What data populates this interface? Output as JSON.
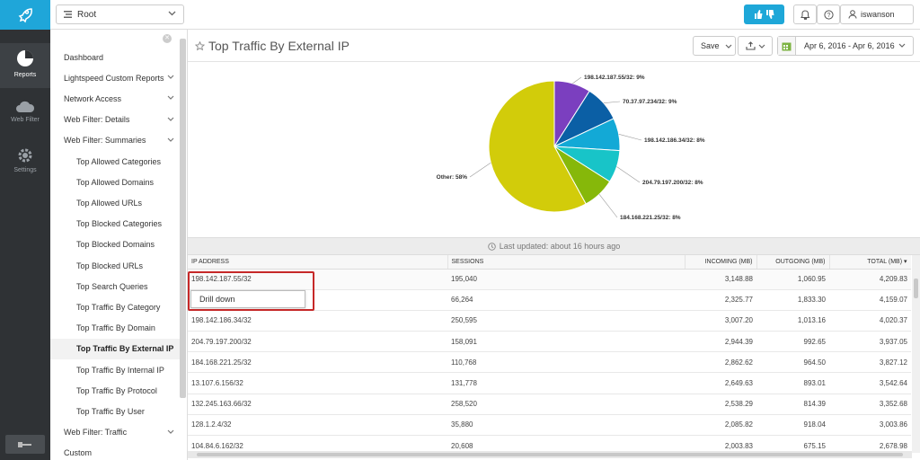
{
  "rail": {
    "items": [
      {
        "label": "Reports",
        "icon": "pie-chart-icon",
        "active": true
      },
      {
        "label": "Web Filter",
        "icon": "cloud-icon",
        "active": false
      },
      {
        "label": "Settings",
        "icon": "gear-icon",
        "active": false
      }
    ]
  },
  "topbar": {
    "root_label": "Root",
    "username": "iswanson"
  },
  "sidenav": {
    "items": [
      {
        "label": "Dashboard",
        "level": 1,
        "chevron": false
      },
      {
        "label": "Lightspeed Custom Reports",
        "level": 1,
        "chevron": true
      },
      {
        "label": "Network Access",
        "level": 1,
        "chevron": true
      },
      {
        "label": "Web Filter: Details",
        "level": 1,
        "chevron": true
      },
      {
        "label": "Web Filter: Summaries",
        "level": 1,
        "chevron": true
      },
      {
        "label": "Top Allowed Categories",
        "level": 2
      },
      {
        "label": "Top Allowed Domains",
        "level": 2
      },
      {
        "label": "Top Allowed URLs",
        "level": 2
      },
      {
        "label": "Top Blocked Categories",
        "level": 2
      },
      {
        "label": "Top Blocked Domains",
        "level": 2
      },
      {
        "label": "Top Blocked URLs",
        "level": 2
      },
      {
        "label": "Top Search Queries",
        "level": 2
      },
      {
        "label": "Top Traffic By Category",
        "level": 2
      },
      {
        "label": "Top Traffic By Domain",
        "level": 2
      },
      {
        "label": "Top Traffic By External IP",
        "level": 2,
        "active": true
      },
      {
        "label": "Top Traffic By Internal IP",
        "level": 2
      },
      {
        "label": "Top Traffic By Protocol",
        "level": 2
      },
      {
        "label": "Top Traffic By User",
        "level": 2
      },
      {
        "label": "Web Filter: Traffic",
        "level": 1,
        "chevron": true
      },
      {
        "label": "Custom",
        "level": 1,
        "chevron": false
      }
    ]
  },
  "main": {
    "title": "Top Traffic By External IP",
    "save_label": "Save",
    "date_range": "Apr 6, 2016 - Apr 6, 2016",
    "last_updated": "Last updated: about 16 hours ago",
    "drill_down_label": "Drill down"
  },
  "chart_data": {
    "type": "pie",
    "slices": [
      {
        "label": "198.142.187.55/32: 9%",
        "value": 9,
        "color": "#7b3fbf"
      },
      {
        "label": "70.37.97.234/32: 9%",
        "value": 9,
        "color": "#0b5fa5"
      },
      {
        "label": "198.142.186.34/32: 8%",
        "value": 8,
        "color": "#13a9d6"
      },
      {
        "label": "204.79.197.200/32: 8%",
        "value": 8,
        "color": "#18c4c8"
      },
      {
        "label": "184.168.221.25/32: 8%",
        "value": 8,
        "color": "#86b80a"
      },
      {
        "label": "Other: 58%",
        "value": 58,
        "color": "#d2cc0a"
      }
    ]
  },
  "table": {
    "columns": [
      "IP ADDRESS",
      "SESSIONS",
      "INCOMING (MB)",
      "OUTGOING (MB)",
      "TOTAL (MB) ▾"
    ],
    "rows": [
      [
        "198.142.187.55/32",
        "195,040",
        "3,148.88",
        "1,060.95",
        "4,209.83"
      ],
      [
        "",
        "66,264",
        "2,325.77",
        "1,833.30",
        "4,159.07"
      ],
      [
        "198.142.186.34/32",
        "250,595",
        "3,007.20",
        "1,013.16",
        "4,020.37"
      ],
      [
        "204.79.197.200/32",
        "158,091",
        "2,944.39",
        "992.65",
        "3,937.05"
      ],
      [
        "184.168.221.25/32",
        "110,768",
        "2,862.62",
        "964.50",
        "3,827.12"
      ],
      [
        "13.107.6.156/32",
        "131,778",
        "2,649.63",
        "893.01",
        "3,542.64"
      ],
      [
        "132.245.163.66/32",
        "258,520",
        "2,538.29",
        "814.39",
        "3,352.68"
      ],
      [
        "128.1.2.4/32",
        "35,880",
        "2,085.82",
        "918.04",
        "3,003.86"
      ],
      [
        "104.84.6.162/32",
        "20,608",
        "2,003.83",
        "675.15",
        "2,678.98"
      ]
    ]
  }
}
